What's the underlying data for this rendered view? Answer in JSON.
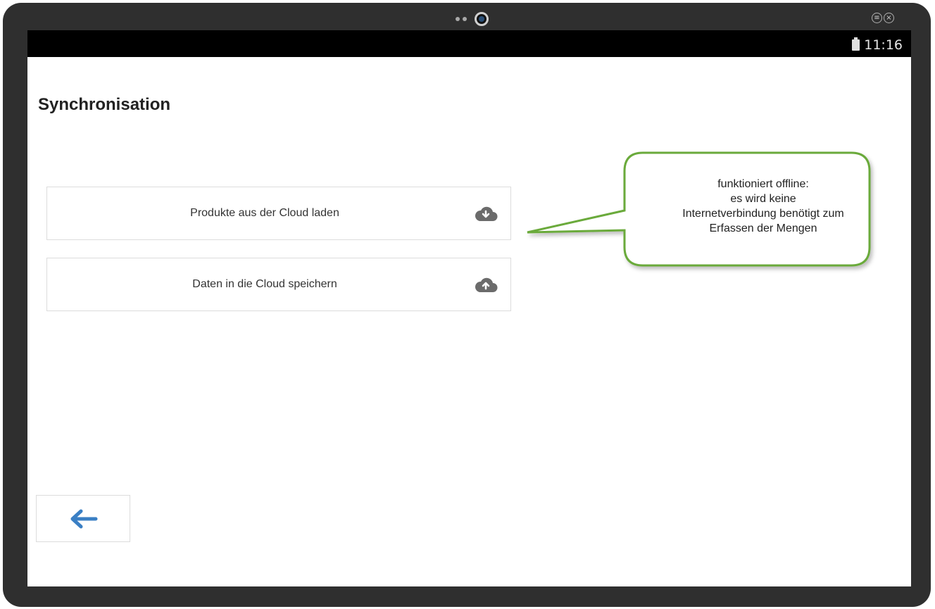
{
  "statusbar": {
    "time": "11:16"
  },
  "page": {
    "title": "Synchronisation"
  },
  "buttons": [
    {
      "label": "Produkte aus der Cloud laden",
      "icon": "cloud-download-icon"
    },
    {
      "label": "Daten in die Cloud speichern",
      "icon": "cloud-upload-icon"
    }
  ],
  "callout": {
    "lines": [
      "funktioniert offline:",
      "es wird keine",
      "Internetverbindung benötigt zum",
      "Erfassen der Mengen"
    ],
    "border_color": "#6aaa3a"
  },
  "back": {
    "icon": "arrow-left-icon",
    "color": "#3a7fc4"
  },
  "colors": {
    "bezel": "#2f2f2f",
    "screen": "#ffffff",
    "icon_gray": "#6b6b6b"
  }
}
